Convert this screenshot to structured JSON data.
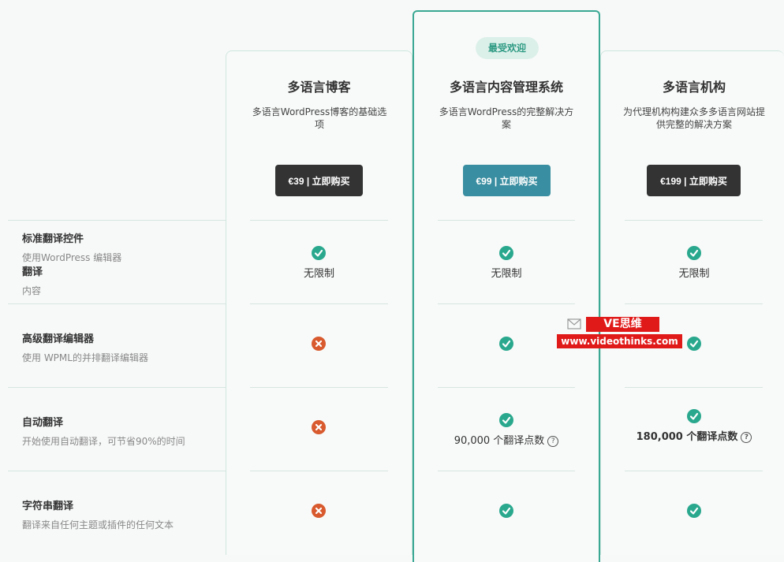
{
  "plans": [
    {
      "name": "多语言博客",
      "desc": "多语言WordPress博客的基础选项",
      "button": "€39 | 立即购买",
      "badge": ""
    },
    {
      "name": "多语言内容管理系统",
      "desc": "多语言WordPress的完整解决方案",
      "button": "€99 | 立即购买",
      "badge": "最受欢迎"
    },
    {
      "name": "多语言机构",
      "desc": "为代理机构构建众多多语言网站提供完整的解决方案",
      "button": "€199 | 立即购买",
      "badge": ""
    }
  ],
  "features": [
    {
      "title": "标准翻译控件",
      "desc": "使用WordPress 编辑器",
      "title2": "翻译",
      "desc2": "内容",
      "cells": [
        {
          "icon": "check-icon",
          "text": "无限制"
        },
        {
          "icon": "check-icon",
          "text": "无限制"
        },
        {
          "icon": "check-icon",
          "text": "无限制"
        }
      ]
    },
    {
      "title": "高级翻译编辑器",
      "desc": "使用 WPML的并排翻译编辑器",
      "cells": [
        {
          "icon": "cross-icon",
          "text": ""
        },
        {
          "icon": "check-icon",
          "text": ""
        },
        {
          "icon": "check-icon",
          "text": ""
        }
      ]
    },
    {
      "title": "自动翻译",
      "desc": "开始使用自动翻译，可节省90%的时间",
      "cells": [
        {
          "icon": "cross-icon",
          "text": ""
        },
        {
          "icon": "check-icon",
          "text": "90,000 个翻译点数"
        },
        {
          "icon": "check-icon",
          "text": "180,000 个翻译点数"
        }
      ]
    },
    {
      "title": "字符串翻译",
      "desc": "翻译来自任何主题或插件的任何文本",
      "cells": [
        {
          "icon": "cross-icon",
          "text": ""
        },
        {
          "icon": "check-icon",
          "text": ""
        },
        {
          "icon": "check-icon",
          "text": ""
        }
      ]
    }
  ],
  "help_icon": "?",
  "watermark": {
    "line1": "VE思维",
    "line2": "www.videothinks.com"
  },
  "colors": {
    "check": "#2aa88e",
    "cross": "#d85a2e",
    "accent": "#3aa893",
    "buy_dark": "#333333",
    "buy_teal": "#3a8ea1"
  }
}
